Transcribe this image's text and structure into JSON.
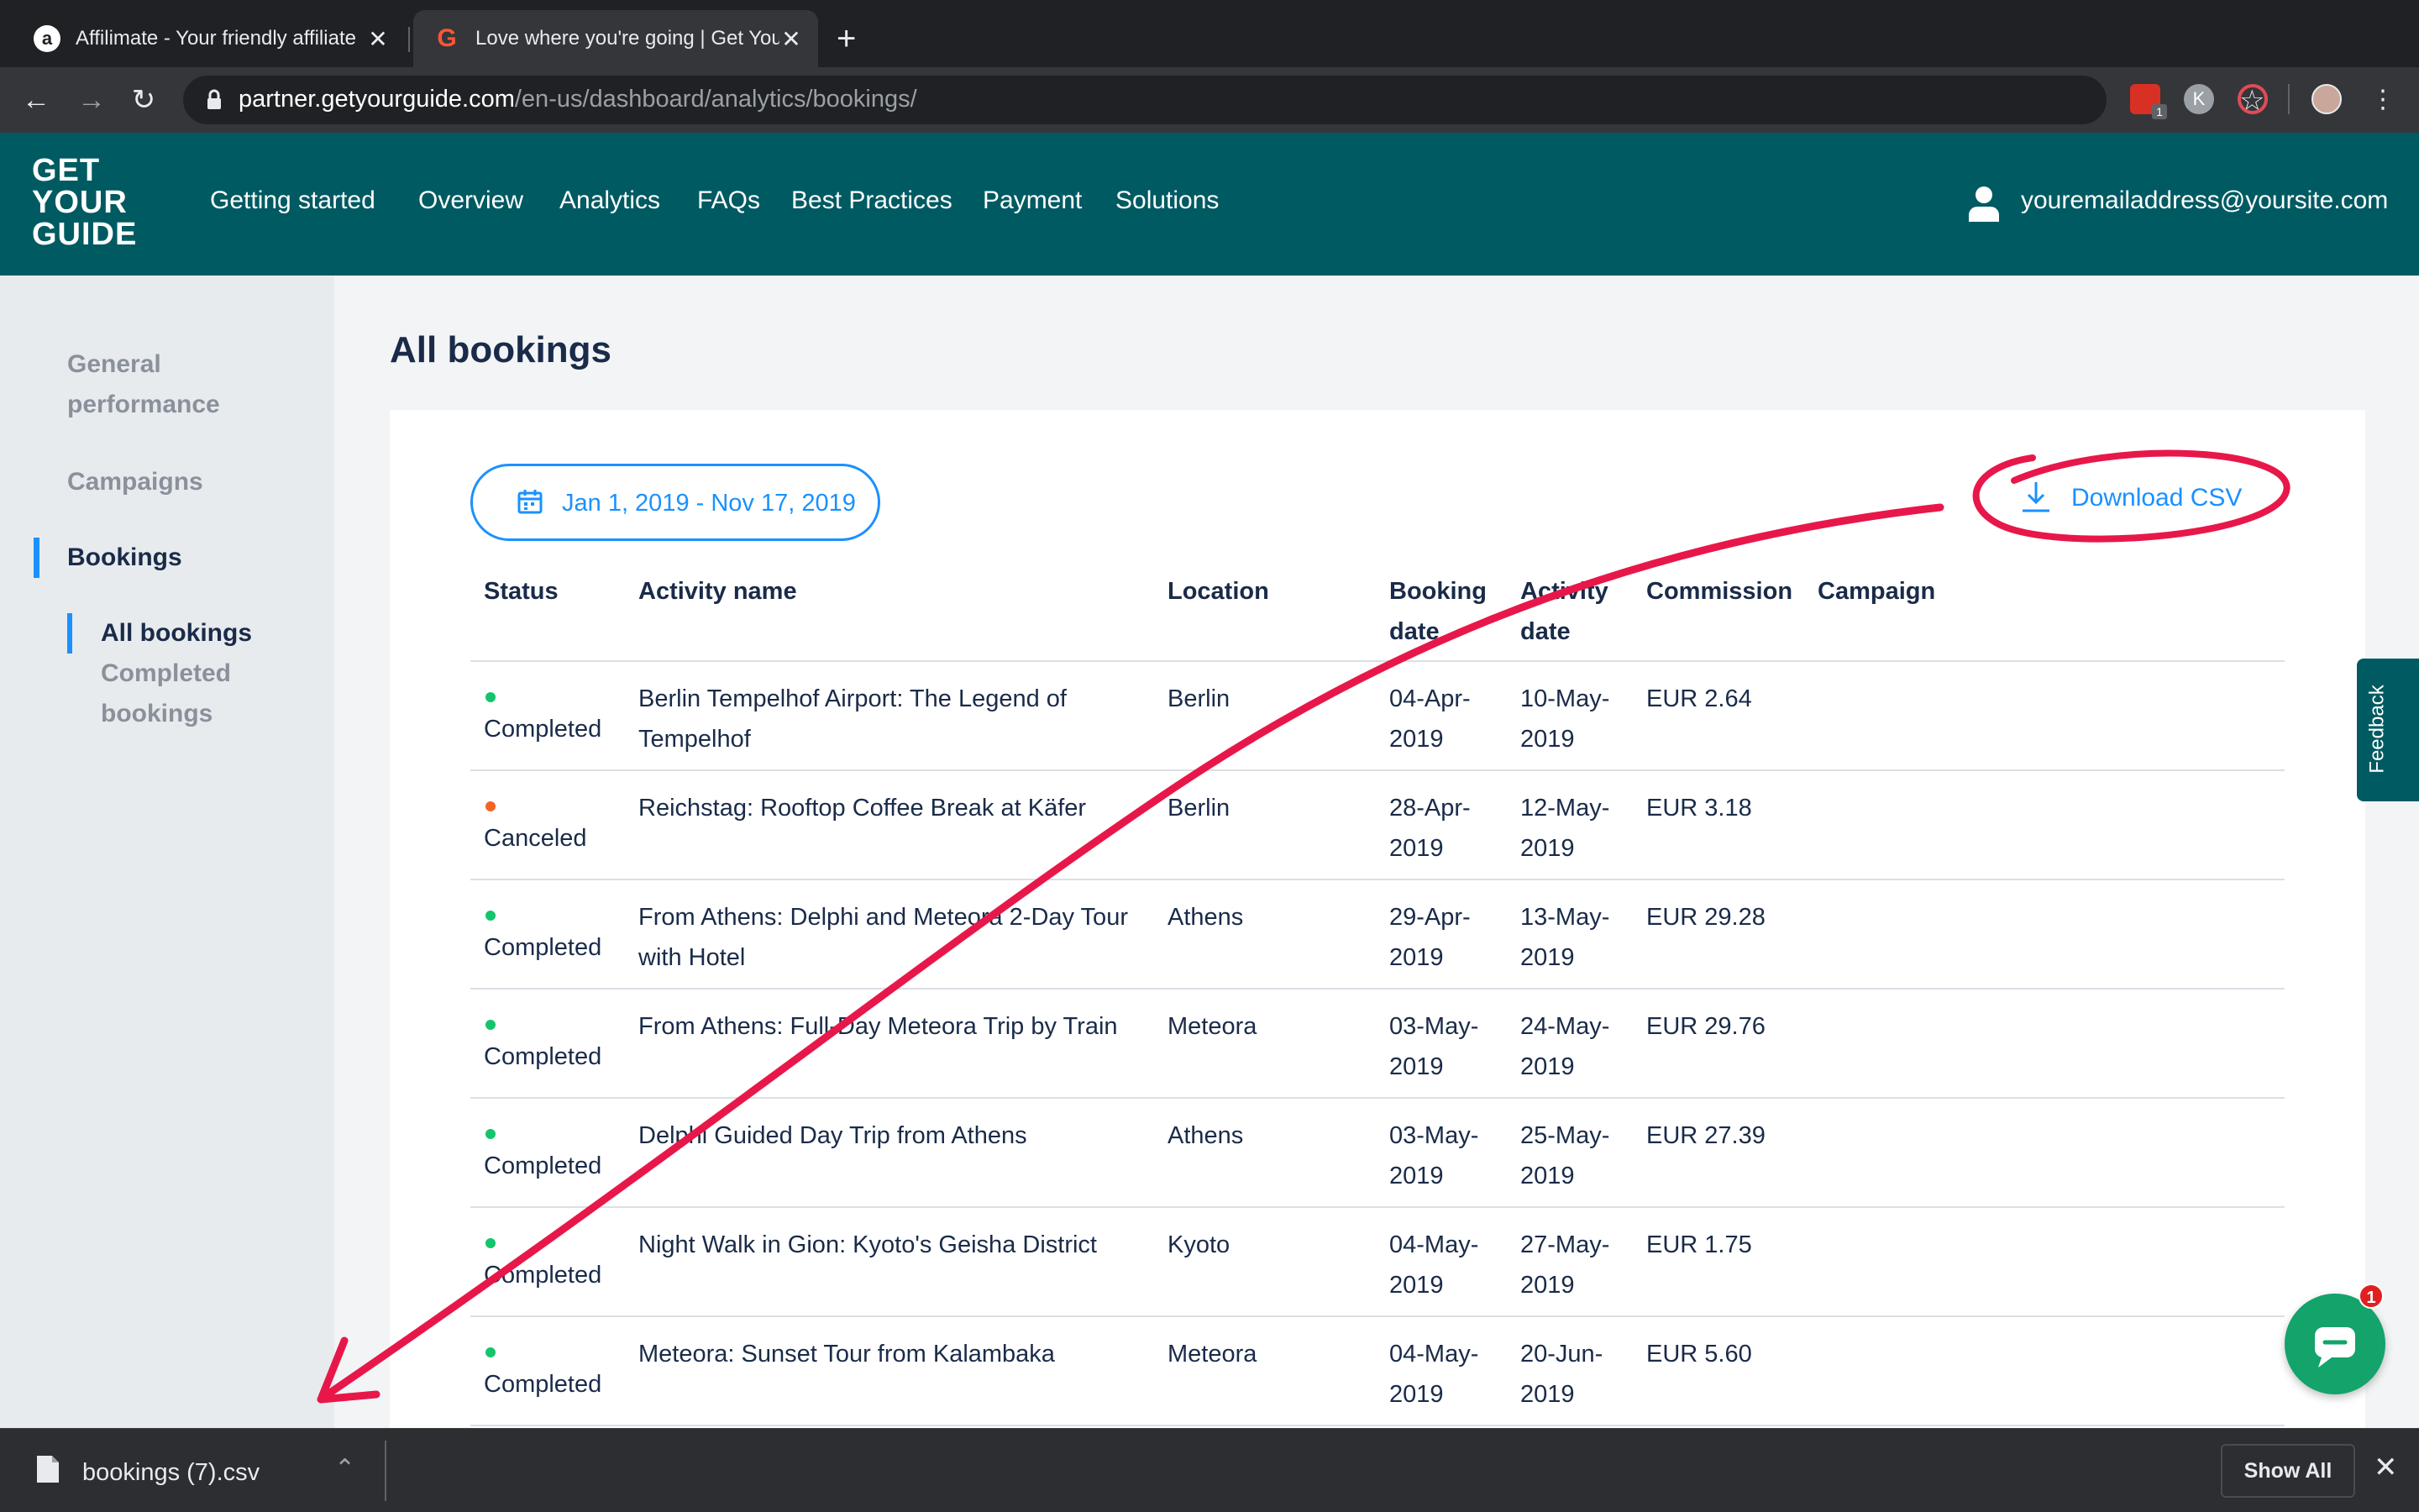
{
  "browser": {
    "tabs": [
      {
        "title": "Affilimate - Your friendly affiliate",
        "favicon": "a"
      },
      {
        "title": "Love where you're going | Get Your Guide",
        "favicon": "G"
      }
    ],
    "url": {
      "host": "partner.getyourguide.com",
      "path": "/en-us/dashboard/analytics/bookings/"
    },
    "extension_badge": "1",
    "avatar_letter": "K"
  },
  "header": {
    "logo_lines": [
      "GET",
      "YOUR",
      "GUIDE"
    ],
    "nav": [
      "Getting started",
      "Overview",
      "Analytics",
      "FAQs",
      "Best Practices",
      "Payment",
      "Solutions"
    ],
    "user_email": "youremailaddress@yoursite.com"
  },
  "sidebar": {
    "items": [
      "General performance",
      "Campaigns",
      "Bookings"
    ],
    "sub_items": [
      "All bookings",
      "Completed bookings"
    ]
  },
  "main": {
    "title": "All bookings",
    "date_range": "Jan 1, 2019 - Nov 17, 2019",
    "download_label": "Download CSV",
    "columns": [
      "Status",
      "Activity name",
      "Location",
      "Booking date",
      "Activity date",
      "Commission",
      "Campaign"
    ],
    "rows": [
      {
        "status": "Completed",
        "activity": "Berlin Tempelhof Airport: The Legend of Tempelhof",
        "location": "Berlin",
        "booking_date": "04-Apr-2019",
        "activity_date": "10-May-2019",
        "commission": "EUR 2.64",
        "campaign": ""
      },
      {
        "status": "Canceled",
        "activity": "Reichstag: Rooftop Coffee Break at Käfer",
        "location": "Berlin",
        "booking_date": "28-Apr-2019",
        "activity_date": "12-May-2019",
        "commission": "EUR 3.18",
        "campaign": ""
      },
      {
        "status": "Completed",
        "activity": "From Athens: Delphi and Meteora 2-Day Tour with Hotel",
        "location": "Athens",
        "booking_date": "29-Apr-2019",
        "activity_date": "13-May-2019",
        "commission": "EUR 29.28",
        "campaign": ""
      },
      {
        "status": "Completed",
        "activity": "From Athens: Full-Day Meteora Trip by Train",
        "location": "Meteora",
        "booking_date": "03-May-2019",
        "activity_date": "24-May-2019",
        "commission": "EUR 29.76",
        "campaign": ""
      },
      {
        "status": "Completed",
        "activity": "Delphi Guided Day Trip from Athens",
        "location": "Athens",
        "booking_date": "03-May-2019",
        "activity_date": "25-May-2019",
        "commission": "EUR 27.39",
        "campaign": ""
      },
      {
        "status": "Completed",
        "activity": "Night Walk in Gion: Kyoto's Geisha District",
        "location": "Kyoto",
        "booking_date": "04-May-2019",
        "activity_date": "27-May-2019",
        "commission": "EUR 1.75",
        "campaign": ""
      },
      {
        "status": "Completed",
        "activity": "Meteora: Sunset Tour from Kalambaka",
        "location": "Meteora",
        "booking_date": "04-May-2019",
        "activity_date": "20-Jun-2019",
        "commission": "EUR 5.60",
        "campaign": ""
      }
    ]
  },
  "feedback_label": "Feedback",
  "chat_badge": "1",
  "download_bar": {
    "file_name": "bookings (7).csv",
    "show_all": "Show All"
  },
  "colors": {
    "brand": "#005a62",
    "accent": "#1a91ff",
    "completed": "#13c56b",
    "canceled": "#f26522",
    "annotation": "#e8174a"
  }
}
